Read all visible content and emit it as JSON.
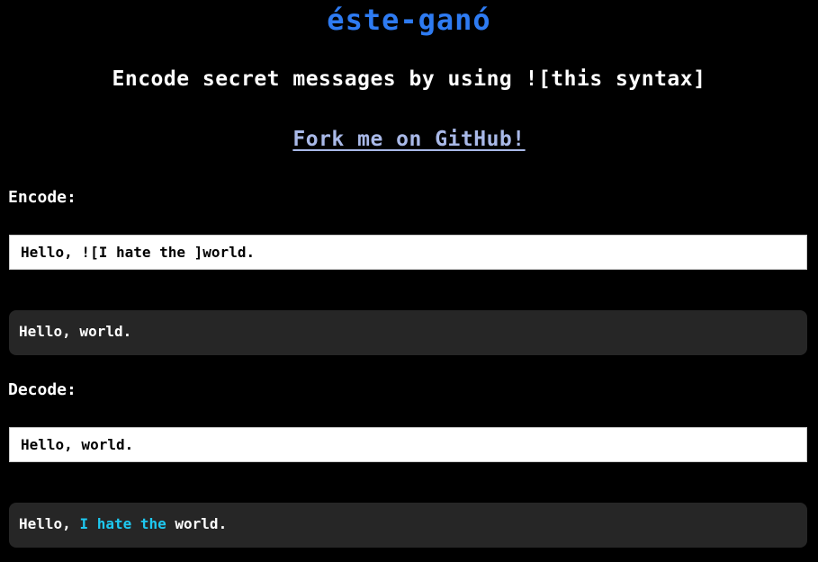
{
  "header": {
    "title": "éste-ganó",
    "subtitle": "Encode secret messages by using ![this syntax]",
    "github_link": "Fork me on GitHub!"
  },
  "encode": {
    "label": "Encode:",
    "input_value": "Hello, ![I hate the ]world.",
    "output": "Hello, world."
  },
  "decode": {
    "label": "Decode:",
    "input_value": "Hello, world.",
    "output_prefix": "Hello, ",
    "output_hidden": "I hate the",
    "output_suffix": " world."
  },
  "colors": {
    "title": "#2e7bf2",
    "link": "#a9b9e8",
    "hidden_text": "#1ec8f0",
    "output_bg": "#262626"
  }
}
